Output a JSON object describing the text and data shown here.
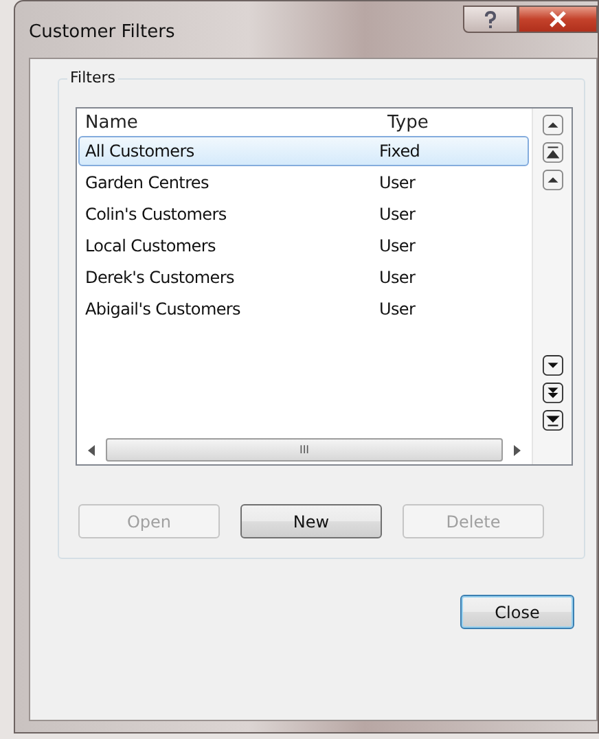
{
  "window": {
    "title": "Customer Filters"
  },
  "group": {
    "title": "Filters"
  },
  "table": {
    "columns": [
      "Name",
      "Type"
    ],
    "rows": [
      {
        "name": "All Customers",
        "type": "Fixed",
        "selected": true
      },
      {
        "name": "Garden Centres",
        "type": "User",
        "selected": false
      },
      {
        "name": "Colin's Customers",
        "type": "User",
        "selected": false
      },
      {
        "name": "Local Customers",
        "type": "User",
        "selected": false
      },
      {
        "name": "Derek's Customers",
        "type": "User",
        "selected": false
      },
      {
        "name": "Abigail's Customers",
        "type": "User",
        "selected": false
      }
    ],
    "hscroll": {
      "thumb": "III"
    }
  },
  "buttons": [
    {
      "label": "Open",
      "disabled": true
    },
    {
      "label": "New",
      "disabled": false
    },
    {
      "label": "Delete",
      "disabled": true
    }
  ],
  "footer_button": {
    "label": "Close",
    "disabled": false
  }
}
